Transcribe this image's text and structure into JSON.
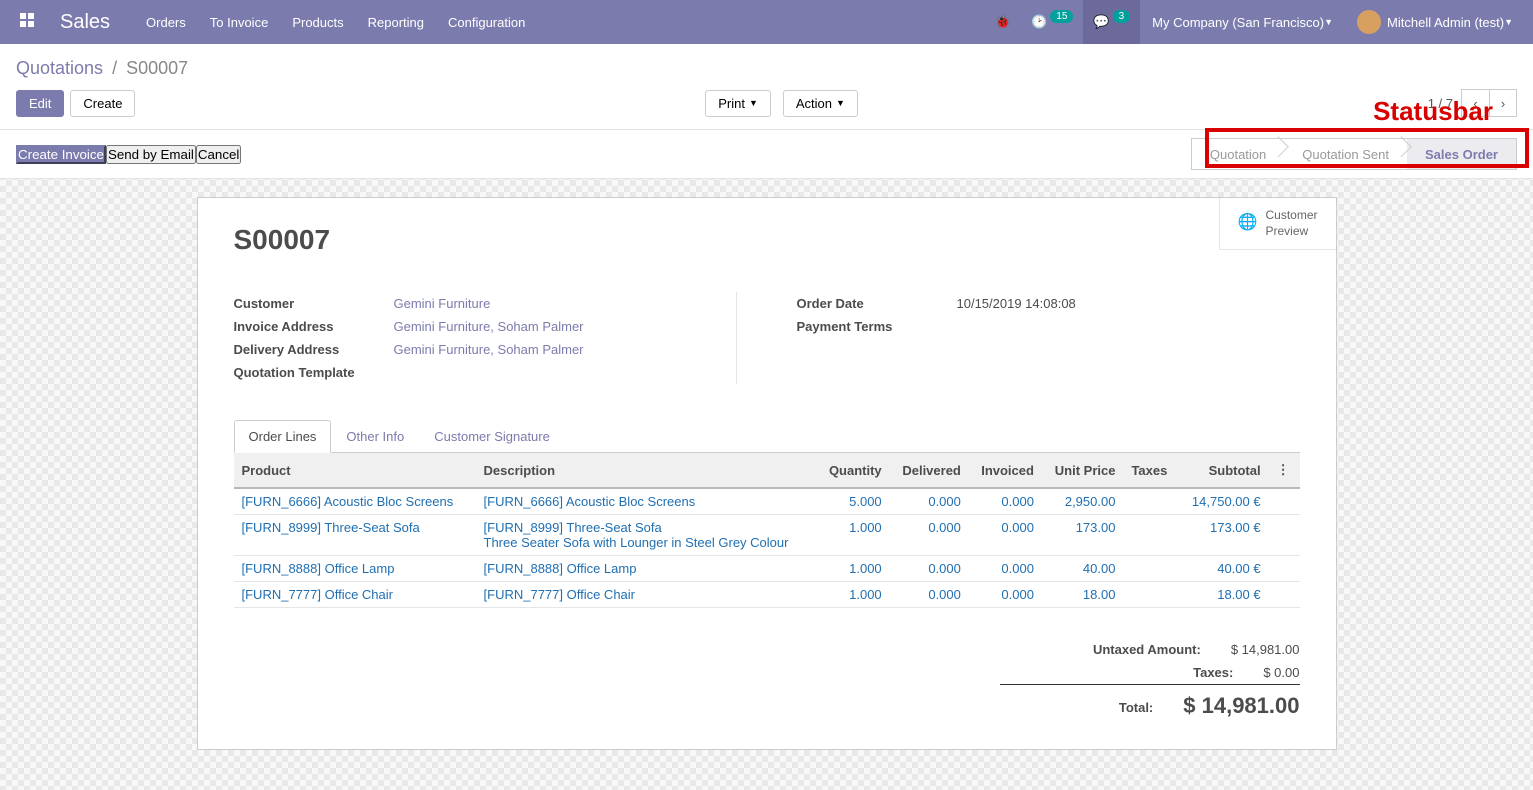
{
  "topbar": {
    "brand": "Sales",
    "menu": [
      "Orders",
      "To Invoice",
      "Products",
      "Reporting",
      "Configuration"
    ],
    "activity_count": "15",
    "msg_count": "3",
    "company": "My Company (San Francisco)",
    "user": "Mitchell Admin (test)"
  },
  "breadcrumb": {
    "parent": "Quotations",
    "current": "S00007"
  },
  "buttons": {
    "edit": "Edit",
    "create": "Create",
    "print": "Print",
    "action": "Action"
  },
  "pager": {
    "text": "1 / 7"
  },
  "status_buttons": {
    "create_invoice": "Create Invoice",
    "send_email": "Send by Email",
    "cancel": "Cancel"
  },
  "statusbar": [
    "Quotation",
    "Quotation Sent",
    "Sales Order"
  ],
  "annotation": "Statusbar",
  "preview": {
    "l1": "Customer",
    "l2": "Preview"
  },
  "record": {
    "name": "S00007",
    "left": [
      {
        "label": "Customer",
        "value": "Gemini Furniture",
        "link": true
      },
      {
        "label": "Invoice Address",
        "value": "Gemini Furniture, Soham Palmer",
        "link": true
      },
      {
        "label": "Delivery Address",
        "value": "Gemini Furniture, Soham Palmer",
        "link": true
      },
      {
        "label": "Quotation Template",
        "value": "",
        "link": false
      }
    ],
    "right": [
      {
        "label": "Order Date",
        "value": "10/15/2019 14:08:08",
        "link": false
      },
      {
        "label": "Payment Terms",
        "value": "",
        "link": false
      }
    ]
  },
  "tabs": [
    "Order Lines",
    "Other Info",
    "Customer Signature"
  ],
  "columns": {
    "product": "Product",
    "description": "Description",
    "qty": "Quantity",
    "delivered": "Delivered",
    "invoiced": "Invoiced",
    "unit": "Unit Price",
    "taxes": "Taxes",
    "subtotal": "Subtotal"
  },
  "lines": [
    {
      "product": "[FURN_6666] Acoustic Bloc Screens",
      "desc": "[FURN_6666] Acoustic Bloc Screens",
      "qty": "5.000",
      "del": "0.000",
      "inv": "0.000",
      "unit": "2,950.00",
      "subtotal": "14,750.00 €"
    },
    {
      "product": "[FURN_8999] Three-Seat Sofa",
      "desc": "[FURN_8999] Three-Seat Sofa\nThree Seater Sofa with Lounger in Steel Grey Colour",
      "qty": "1.000",
      "del": "0.000",
      "inv": "0.000",
      "unit": "173.00",
      "subtotal": "173.00 €"
    },
    {
      "product": "[FURN_8888] Office Lamp",
      "desc": "[FURN_8888] Office Lamp",
      "qty": "1.000",
      "del": "0.000",
      "inv": "0.000",
      "unit": "40.00",
      "subtotal": "40.00 €"
    },
    {
      "product": "[FURN_7777] Office Chair",
      "desc": "[FURN_7777] Office Chair",
      "qty": "1.000",
      "del": "0.000",
      "inv": "0.000",
      "unit": "18.00",
      "subtotal": "18.00 €"
    }
  ],
  "totals": {
    "untaxed": {
      "label": "Untaxed Amount:",
      "value": "$ 14,981.00"
    },
    "taxes": {
      "label": "Taxes:",
      "value": "$ 0.00"
    },
    "total": {
      "label": "Total:",
      "value": "$ 14,981.00"
    }
  }
}
